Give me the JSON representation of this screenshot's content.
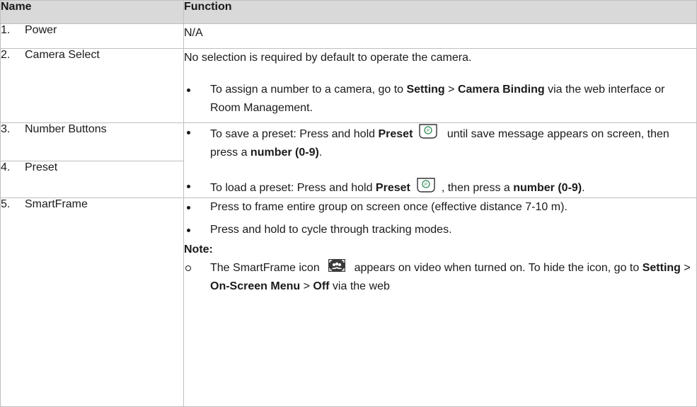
{
  "header": {
    "name": "Name",
    "function": "Function"
  },
  "rows": [
    {
      "num": "1.",
      "name": "Power",
      "text": "N/A"
    },
    {
      "num": "2.",
      "name": "Camera Select",
      "text": "No selection is required by default to operate the camera.",
      "bullet_a": "To assign a number to a camera, go to ",
      "bullet_b": "Setting",
      "bullet_c": " > ",
      "bullet_d": "Camera Binding",
      "bullet_e": " via the web interface or Room Management."
    },
    {
      "num": "3.",
      "name": "Number Buttons",
      "bullet_a": "To save a preset: Press and hold ",
      "bullet_b": "Preset",
      "bullet_c": " until save message appears on screen, then press a ",
      "bullet_d": "number (0-9)",
      "bullet_e": "."
    },
    {
      "num": "4.",
      "name": "Preset",
      "bullet_a": "To load a preset: Press and hold ",
      "bullet_b": "Preset",
      "bullet_c": ", then press a ",
      "bullet_d": "number (0-9)",
      "bullet_e": "."
    },
    {
      "num": "5.",
      "name": "SmartFrame",
      "bullet1": "Press to frame entire group on screen once (effective distance 7-10 m).",
      "bullet2": "Press and hold to cycle through tracking modes.",
      "note": "Note:",
      "sub_a": "The SmartFrame icon ",
      "sub_b": " appears on video when turned on. To hide the icon, go to ",
      "sub_c": "Setting",
      "sub_d": " > ",
      "sub_e": "On-Screen Menu",
      "sub_f": " > ",
      "sub_g": "Off",
      "sub_h": " via the web"
    }
  ],
  "icons": {
    "preset": "preset-button-icon",
    "smartframe": "smartframe-icon"
  }
}
